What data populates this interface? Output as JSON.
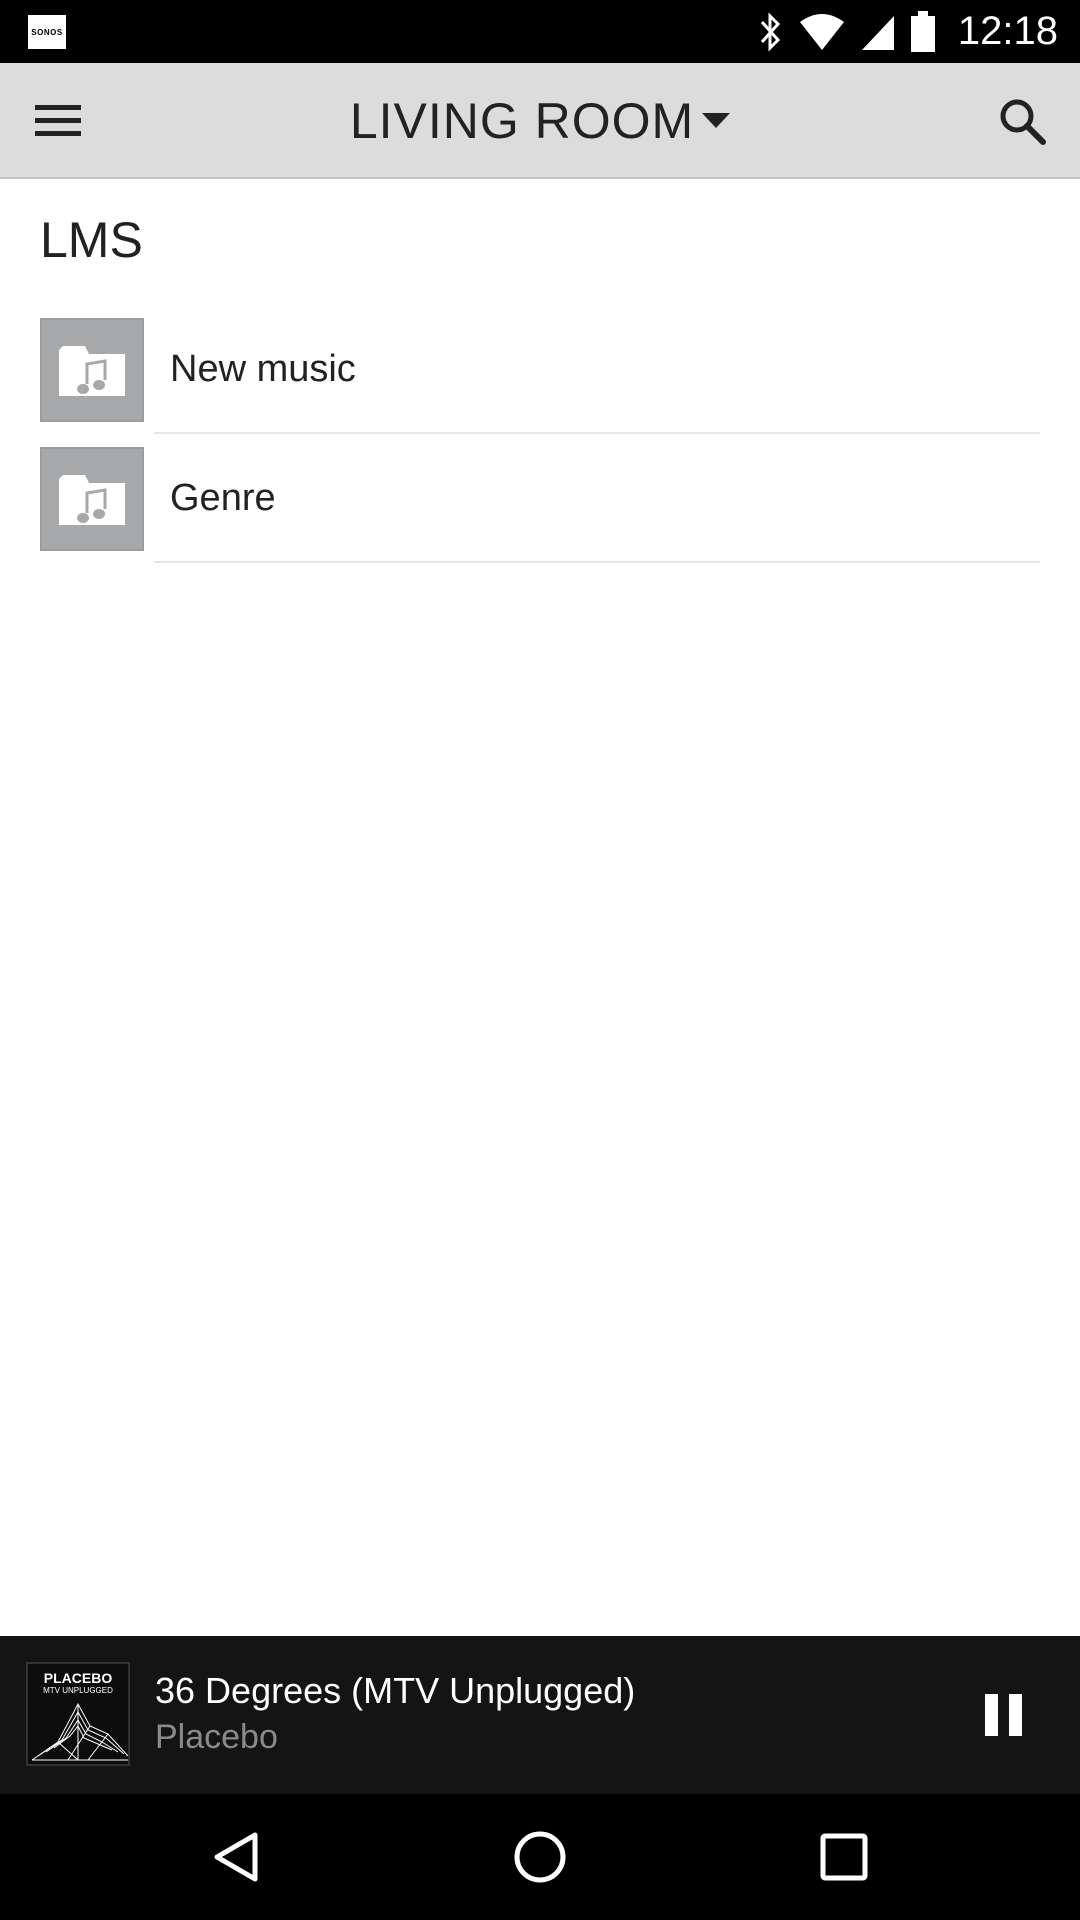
{
  "status_bar": {
    "app_badge": "SONOS",
    "time": "12:18",
    "icons": [
      "bluetooth-icon",
      "wifi-icon",
      "signal-icon",
      "battery-icon"
    ]
  },
  "toolbar": {
    "room": "LIVING ROOM",
    "menu_icon": "hamburger-menu-icon",
    "dropdown_icon": "caret-down-icon",
    "search_icon": "search-icon"
  },
  "content": {
    "section_title": "LMS",
    "items": [
      {
        "label": "New music",
        "icon": "music-folder-icon"
      },
      {
        "label": "Genre",
        "icon": "music-folder-icon"
      }
    ]
  },
  "now_playing": {
    "album_band": "PLACEBO",
    "album_sub": "MTV UNPLUGGED",
    "title": "36 Degrees (MTV Unplugged)",
    "artist": "Placebo",
    "control_icon": "pause-icon"
  },
  "nav_bar": {
    "icons": [
      "back-icon",
      "home-icon",
      "recents-icon"
    ]
  },
  "colors": {
    "toolbar_bg": "#dcdcdc",
    "now_playing_bg": "#141414",
    "thumb_bg": "#a6a8aa"
  }
}
